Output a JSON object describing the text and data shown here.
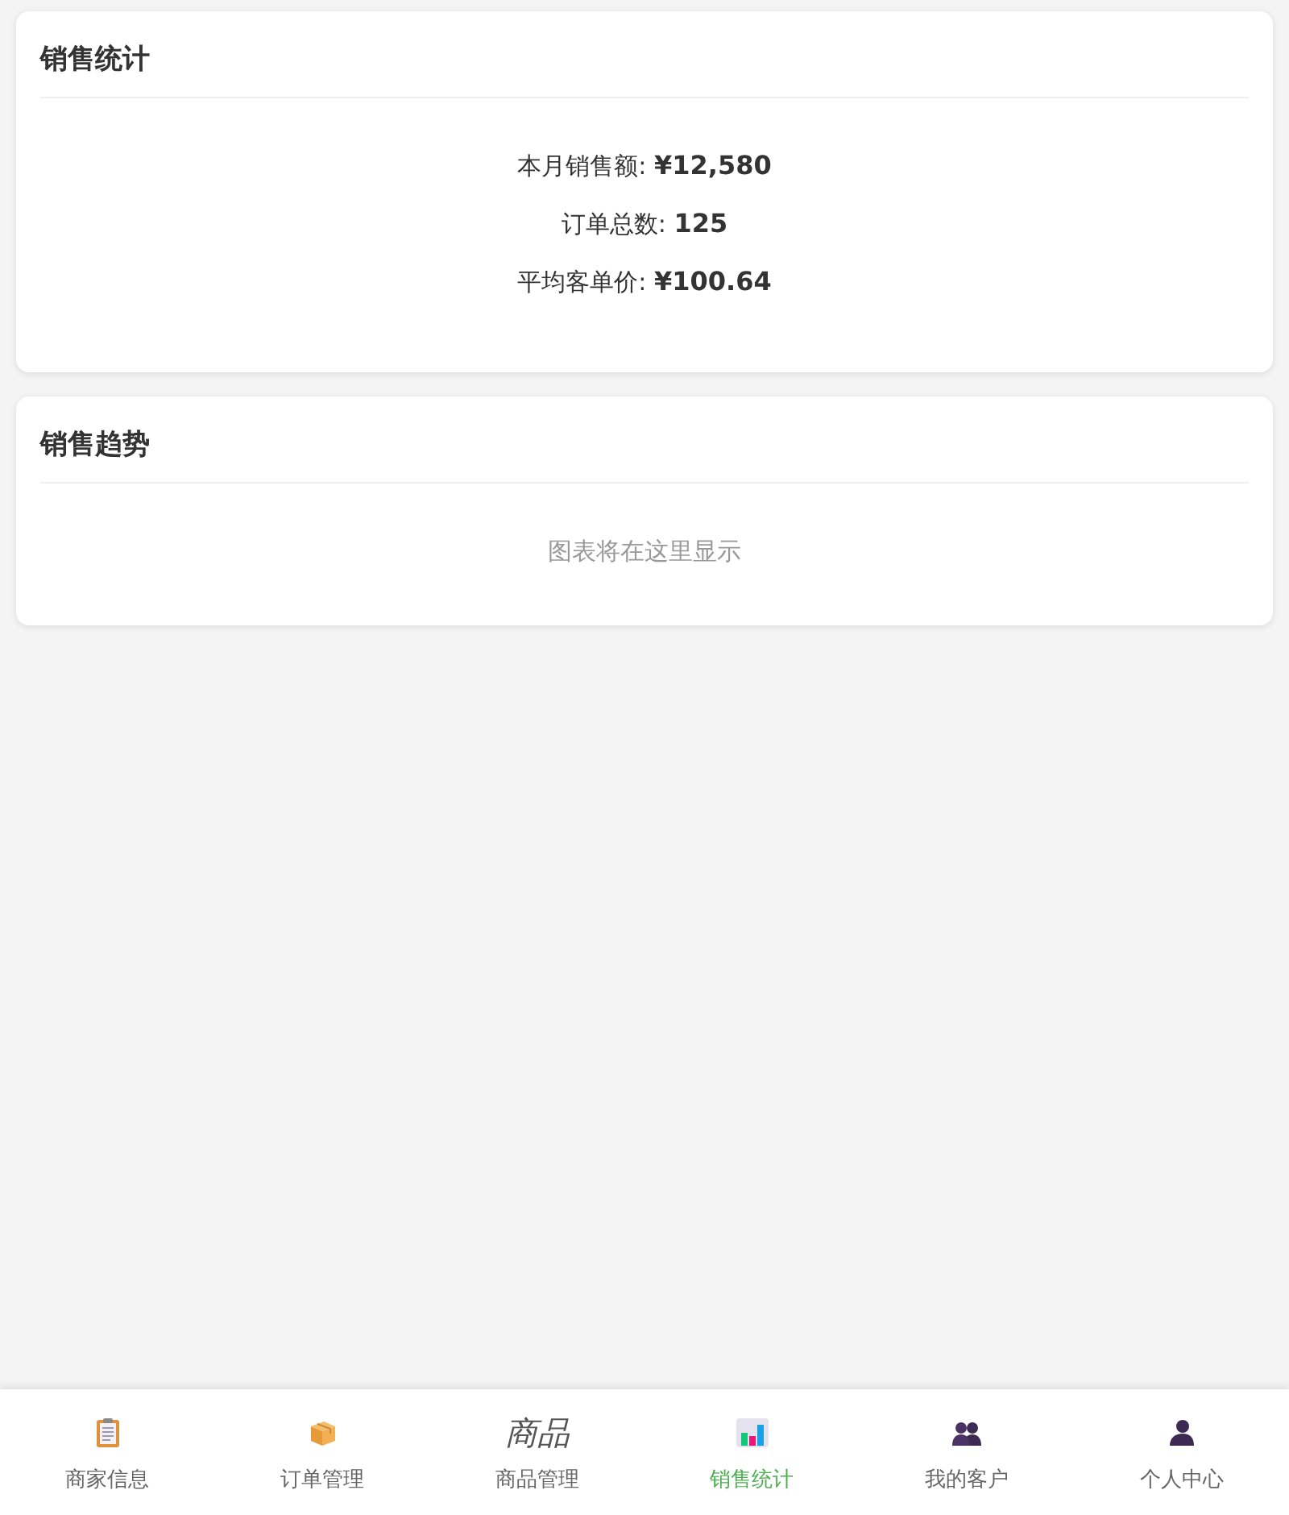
{
  "cards": [
    {
      "title": "销售统计",
      "kind": "stats",
      "lines": [
        "本月销售额: **¥12,580**",
        "订单总数: **125**",
        "平均客单价: **¥100.64**"
      ]
    },
    {
      "title": "销售趋势",
      "kind": "placeholder",
      "note": "图表将在这里显示"
    }
  ],
  "nav": [
    {
      "label": "商家信息",
      "kind": "clipboard",
      "selected": false
    },
    {
      "label": "订单管理",
      "kind": "box",
      "selected": false
    },
    {
      "label": "商品管理",
      "kind": "text",
      "icon_text": "商品",
      "selected": false
    },
    {
      "label": "销售统计",
      "kind": "chart",
      "selected": true
    },
    {
      "label": "我的客户",
      "kind": "people",
      "selected": false
    },
    {
      "label": "个人中心",
      "kind": "person",
      "selected": false
    }
  ]
}
